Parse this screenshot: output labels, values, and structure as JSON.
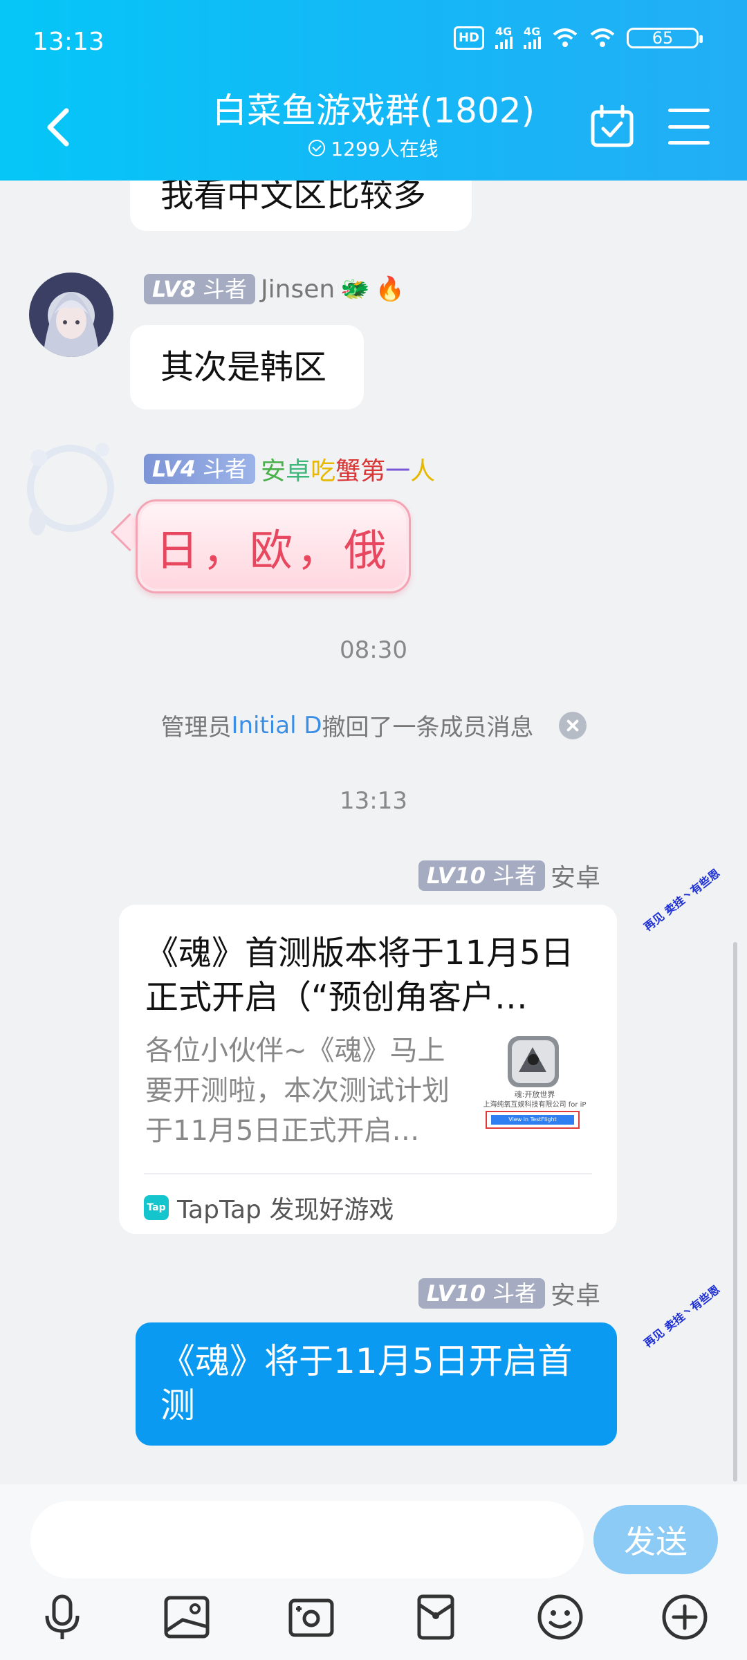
{
  "status_bar": {
    "time": "13:13",
    "hd_label": "HD",
    "net1": "4G",
    "net2": "4G",
    "battery": "65"
  },
  "header": {
    "title": "白菜鱼游戏群(1802)",
    "online": "1299人在线"
  },
  "messages": {
    "m0_text": "我看中文区比较多",
    "m1_level": "LV8",
    "m1_rank": "斗者",
    "m1_name": "Jinsen",
    "m1_text": "其次是韩区",
    "m2_level": "LV4",
    "m2_rank": "斗者",
    "m2_name_chars": [
      "安",
      "卓",
      "吃",
      "蟹",
      "第",
      "一",
      "人"
    ],
    "m2_text": "日，欧，俄",
    "time1": "08:30",
    "recall_prefix": "管理员 ",
    "recall_name": "Initial D",
    "recall_suffix": "撤回了一条成员消息",
    "time2": "13:13",
    "m3_level": "LV10",
    "m3_rank": "斗者",
    "m3_name": "安卓",
    "card_title": "《魂》首测版本将于11月5日正式开启（“预创角客户…",
    "card_desc": "各位小伙伴~《魂》马上要开测啦，本次测试计划于11月5日正式开启…",
    "card_thumb_caption1": "魂:开放世界",
    "card_thumb_caption2": "上海纯氧互娱科技有限公司 for iP",
    "card_thumb_button": "View in TestFlight",
    "card_source_logo": "Tap",
    "card_source": "TapTap 发现好游戏",
    "m4_level": "LV10",
    "m4_rank": "斗者",
    "m4_name": "安卓",
    "m4_text": "《魂》将于11月5日开启首测",
    "sticker_text": "再见 卖挂丶有些恩"
  },
  "input": {
    "placeholder": "",
    "send_label": "发送"
  },
  "toolbar": {
    "icons": [
      "microphone-icon",
      "image-icon",
      "camera-icon",
      "red-packet-icon",
      "emoji-icon",
      "plus-icon"
    ]
  },
  "colors": {
    "header_start": "#05c6f7",
    "header_end": "#22aef5",
    "self_bubble": "#0a9af2",
    "send_button": "#8ccbf5",
    "link": "#3b8ee6"
  }
}
